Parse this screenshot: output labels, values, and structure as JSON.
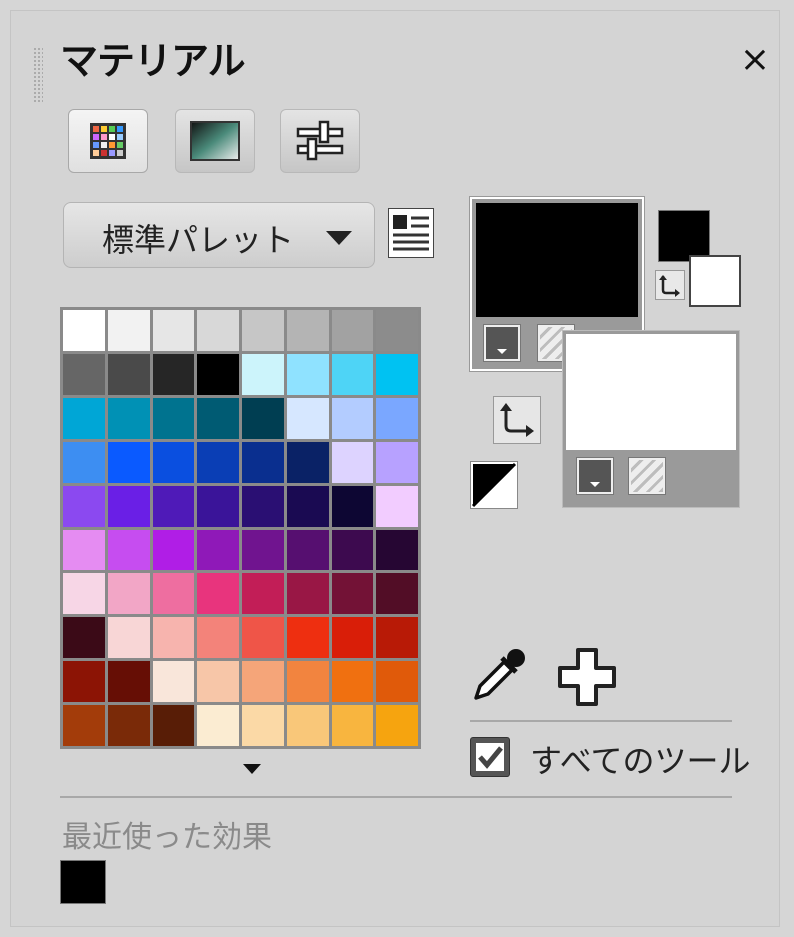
{
  "panel": {
    "title": "マテリアル",
    "close_glyph": "×"
  },
  "tabs": [
    {
      "name": "palette-tab",
      "icon": "swatches-icon",
      "active": true
    },
    {
      "name": "gradient-tab",
      "icon": "gradient-icon",
      "active": false
    },
    {
      "name": "adjust-tab",
      "icon": "sliders-icon",
      "active": false
    }
  ],
  "palette": {
    "selected": "標準パレット",
    "menu_icon": "palette-menu-icon",
    "swatches": [
      "#ffffff",
      "#f2f2f2",
      "#e6e6e6",
      "#d8d8d8",
      "#c6c6c6",
      "#b4b4b4",
      "#a2a2a2",
      "#8c8c8c",
      "#666666",
      "#4a4a4a",
      "#262626",
      "#000000",
      "#ccf4fb",
      "#8fe2ff",
      "#4ed4f6",
      "#00c2f2",
      "#00a6d6",
      "#0091b5",
      "#00738f",
      "#005b73",
      "#003e52",
      "#d6e7ff",
      "#b3ccff",
      "#7aa7ff",
      "#3d8ef2",
      "#0a5aff",
      "#0a4fe0",
      "#0a3eb5",
      "#0a2f8f",
      "#0a2266",
      "#ddd3ff",
      "#b7a1ff",
      "#8b49f0",
      "#6a1fe6",
      "#4f1ab8",
      "#3a1499",
      "#2a0f73",
      "#1a0a52",
      "#0d0633",
      "#f2ccff",
      "#e58cf2",
      "#c64df0",
      "#b01ee6",
      "#8f19b8",
      "#70148f",
      "#560f70",
      "#3d0a4f",
      "#260633",
      "#f7d6e6",
      "#f2a6c6",
      "#ee6ea0",
      "#e8347d",
      "#c21e57",
      "#991745",
      "#731236",
      "#520d26",
      "#3b0a17",
      "#f8d6d6",
      "#f7b4ae",
      "#f3837a",
      "#ef5548",
      "#ee2f10",
      "#d91e08",
      "#b81a06",
      "#8c1405",
      "#660e05",
      "#f9e6da",
      "#f7c6a8",
      "#f5a579",
      "#f2843f",
      "#f07010",
      "#e05a0a",
      "#a33c0a",
      "#7a2a08",
      "#581d06",
      "#fbecd2",
      "#fbd9a6",
      "#f9c779",
      "#f8b53f",
      "#f6a40f"
    ]
  },
  "current": {
    "fg": "#000000",
    "bg": "#ffffff"
  },
  "recent": {
    "label": "最近使った効果",
    "colors": [
      "#000000"
    ]
  },
  "all_tools": {
    "label": "すべてのツール",
    "checked": true
  }
}
